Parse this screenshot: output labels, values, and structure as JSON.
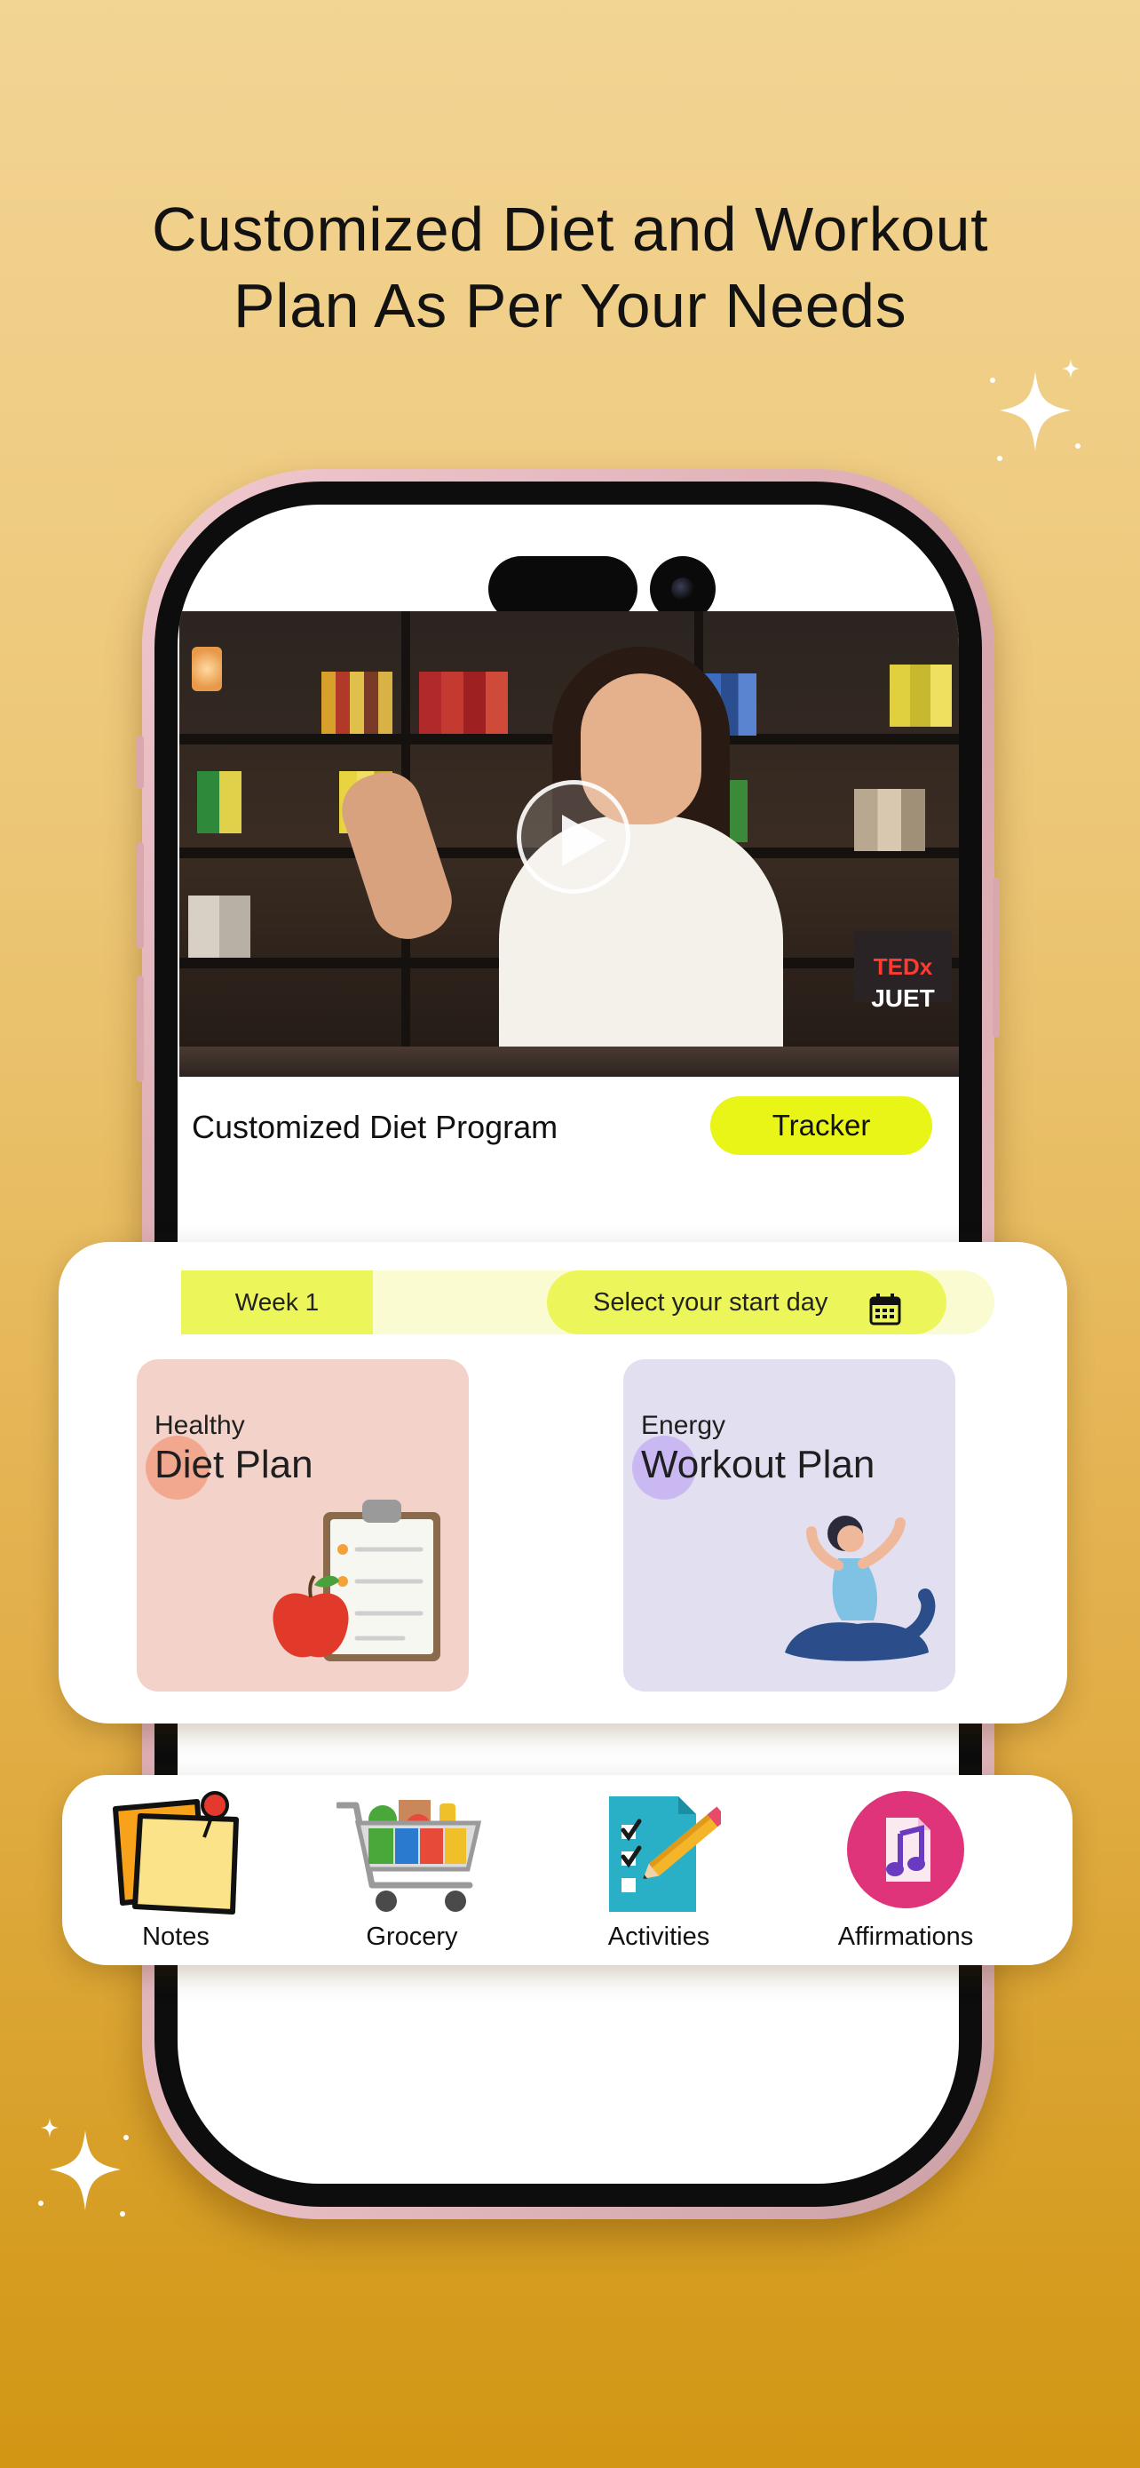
{
  "headline": {
    "line1": "Customized  Diet and Workout",
    "line2": "Plan As Per Your Needs"
  },
  "video": {
    "badge_text": "JUET",
    "badge_brand": "TEDx",
    "play_icon": "play-icon"
  },
  "program": {
    "title": "Customized Diet Program",
    "tracker_label": "Tracker"
  },
  "week_bar": {
    "week_label": "Week 1",
    "start_day_label": "Select your start day",
    "calendar_icon": "calendar-icon"
  },
  "plans": [
    {
      "kicker": "Healthy",
      "title": "Diet Plan",
      "icon": "clipboard-apple-icon"
    },
    {
      "kicker": "Energy",
      "title": "Workout Plan",
      "icon": "yoga-pose-icon"
    }
  ],
  "quick_links": [
    {
      "label": "Notes",
      "icon": "sticky-notes-icon"
    },
    {
      "label": "Grocery",
      "icon": "shopping-cart-icon"
    },
    {
      "label": "Activities",
      "icon": "checklist-pencil-icon"
    },
    {
      "label": "Affirmations",
      "icon": "music-note-icon"
    }
  ],
  "colors": {
    "accent_yellow": "#e8f516",
    "background_top": "#f2d493",
    "background_bottom": "#d19613",
    "diet_tile": "#f3d3c9",
    "workout_tile": "#e2e0f0"
  }
}
